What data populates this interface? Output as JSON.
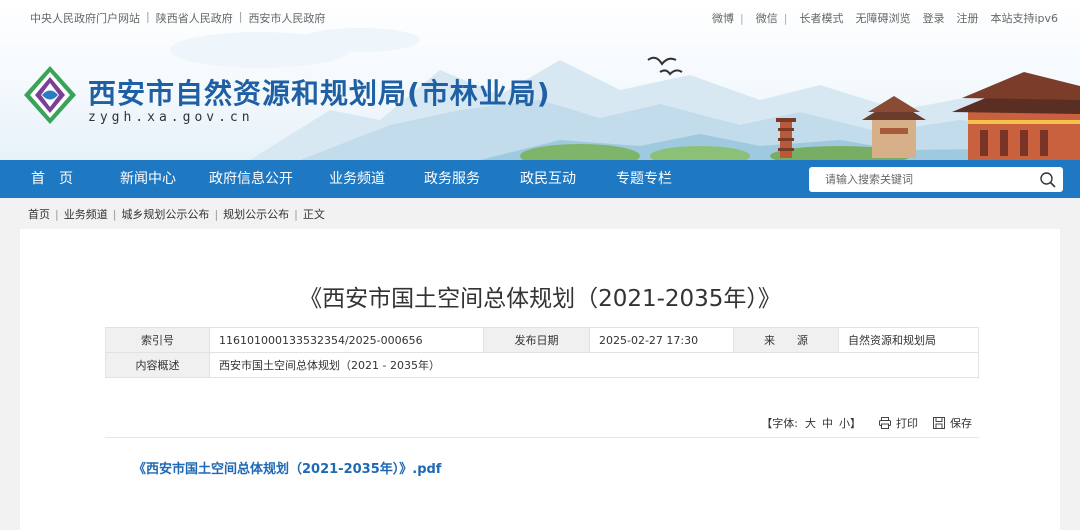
{
  "top_links_left": [
    "中央人民政府门户网站",
    "陕西省人民政府",
    "西安市人民政府"
  ],
  "top_links_right": [
    "微博",
    "微信",
    "长者模式",
    "无障碍浏览",
    "登录",
    "注册",
    "本站支持ipv6"
  ],
  "site": {
    "title": "西安市自然资源和规划局(市林业局)",
    "domain": "zygh.xa.gov.cn",
    "logo_icon": "diamond-emblem-icon"
  },
  "nav": {
    "items": [
      "首　页",
      "新闻中心",
      "政府信息公开",
      "业务频道",
      "政务服务",
      "政民互动",
      "专题专栏"
    ],
    "search_placeholder": "请输入搜索关键词",
    "search_icon": "search-icon"
  },
  "breadcrumb": [
    "首页",
    "业务频道",
    "城乡规划公示公布",
    "规划公示公布",
    "正文"
  ],
  "article": {
    "title": "《西安市国土空间总体规划（2021-2035年）》",
    "meta": {
      "index_label": "索引号",
      "index_value": "116101000133532354/2025-000656",
      "date_label": "发布日期",
      "date_value": "2025-02-27 17:30",
      "source_label": "来　　源",
      "source_value": "自然资源和规划局",
      "summary_label": "内容概述",
      "summary_value": "西安市国土空间总体规划（2021 - 2035年）"
    },
    "tools": {
      "font_label": "【字体:",
      "font_large": "大",
      "font_medium": "中",
      "font_small": "小】",
      "print_label": "打印",
      "save_label": "保存",
      "print_icon": "printer-icon",
      "save_icon": "save-icon"
    },
    "attachment": "《西安市国土空间总体规划（2021-2035年）》.pdf"
  },
  "colors": {
    "nav_bg": "#1e78c2",
    "title_blue": "#1f5fa4",
    "link_blue": "#1f69b3",
    "page_bg": "#f2f2f2"
  }
}
